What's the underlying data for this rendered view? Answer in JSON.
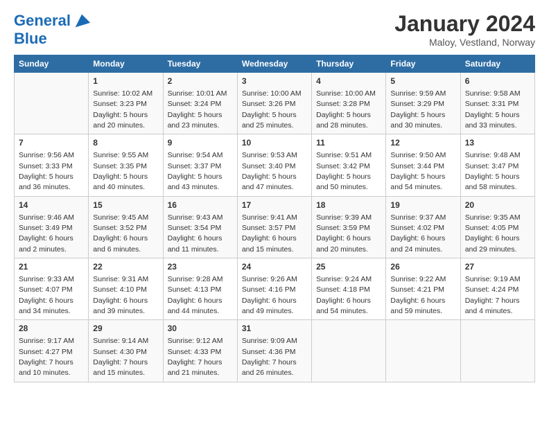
{
  "logo": {
    "line1": "General",
    "line2": "Blue"
  },
  "title": "January 2024",
  "subtitle": "Maloy, Vestland, Norway",
  "days": [
    "Sunday",
    "Monday",
    "Tuesday",
    "Wednesday",
    "Thursday",
    "Friday",
    "Saturday"
  ],
  "weeks": [
    [
      {
        "date": "",
        "sunrise": "",
        "sunset": "",
        "daylight": ""
      },
      {
        "date": "1",
        "sunrise": "Sunrise: 10:02 AM",
        "sunset": "Sunset: 3:23 PM",
        "daylight": "Daylight: 5 hours and 20 minutes."
      },
      {
        "date": "2",
        "sunrise": "Sunrise: 10:01 AM",
        "sunset": "Sunset: 3:24 PM",
        "daylight": "Daylight: 5 hours and 23 minutes."
      },
      {
        "date": "3",
        "sunrise": "Sunrise: 10:00 AM",
        "sunset": "Sunset: 3:26 PM",
        "daylight": "Daylight: 5 hours and 25 minutes."
      },
      {
        "date": "4",
        "sunrise": "Sunrise: 10:00 AM",
        "sunset": "Sunset: 3:28 PM",
        "daylight": "Daylight: 5 hours and 28 minutes."
      },
      {
        "date": "5",
        "sunrise": "Sunrise: 9:59 AM",
        "sunset": "Sunset: 3:29 PM",
        "daylight": "Daylight: 5 hours and 30 minutes."
      },
      {
        "date": "6",
        "sunrise": "Sunrise: 9:58 AM",
        "sunset": "Sunset: 3:31 PM",
        "daylight": "Daylight: 5 hours and 33 minutes."
      }
    ],
    [
      {
        "date": "7",
        "sunrise": "Sunrise: 9:56 AM",
        "sunset": "Sunset: 3:33 PM",
        "daylight": "Daylight: 5 hours and 36 minutes."
      },
      {
        "date": "8",
        "sunrise": "Sunrise: 9:55 AM",
        "sunset": "Sunset: 3:35 PM",
        "daylight": "Daylight: 5 hours and 40 minutes."
      },
      {
        "date": "9",
        "sunrise": "Sunrise: 9:54 AM",
        "sunset": "Sunset: 3:37 PM",
        "daylight": "Daylight: 5 hours and 43 minutes."
      },
      {
        "date": "10",
        "sunrise": "Sunrise: 9:53 AM",
        "sunset": "Sunset: 3:40 PM",
        "daylight": "Daylight: 5 hours and 47 minutes."
      },
      {
        "date": "11",
        "sunrise": "Sunrise: 9:51 AM",
        "sunset": "Sunset: 3:42 PM",
        "daylight": "Daylight: 5 hours and 50 minutes."
      },
      {
        "date": "12",
        "sunrise": "Sunrise: 9:50 AM",
        "sunset": "Sunset: 3:44 PM",
        "daylight": "Daylight: 5 hours and 54 minutes."
      },
      {
        "date": "13",
        "sunrise": "Sunrise: 9:48 AM",
        "sunset": "Sunset: 3:47 PM",
        "daylight": "Daylight: 5 hours and 58 minutes."
      }
    ],
    [
      {
        "date": "14",
        "sunrise": "Sunrise: 9:46 AM",
        "sunset": "Sunset: 3:49 PM",
        "daylight": "Daylight: 6 hours and 2 minutes."
      },
      {
        "date": "15",
        "sunrise": "Sunrise: 9:45 AM",
        "sunset": "Sunset: 3:52 PM",
        "daylight": "Daylight: 6 hours and 6 minutes."
      },
      {
        "date": "16",
        "sunrise": "Sunrise: 9:43 AM",
        "sunset": "Sunset: 3:54 PM",
        "daylight": "Daylight: 6 hours and 11 minutes."
      },
      {
        "date": "17",
        "sunrise": "Sunrise: 9:41 AM",
        "sunset": "Sunset: 3:57 PM",
        "daylight": "Daylight: 6 hours and 15 minutes."
      },
      {
        "date": "18",
        "sunrise": "Sunrise: 9:39 AM",
        "sunset": "Sunset: 3:59 PM",
        "daylight": "Daylight: 6 hours and 20 minutes."
      },
      {
        "date": "19",
        "sunrise": "Sunrise: 9:37 AM",
        "sunset": "Sunset: 4:02 PM",
        "daylight": "Daylight: 6 hours and 24 minutes."
      },
      {
        "date": "20",
        "sunrise": "Sunrise: 9:35 AM",
        "sunset": "Sunset: 4:05 PM",
        "daylight": "Daylight: 6 hours and 29 minutes."
      }
    ],
    [
      {
        "date": "21",
        "sunrise": "Sunrise: 9:33 AM",
        "sunset": "Sunset: 4:07 PM",
        "daylight": "Daylight: 6 hours and 34 minutes."
      },
      {
        "date": "22",
        "sunrise": "Sunrise: 9:31 AM",
        "sunset": "Sunset: 4:10 PM",
        "daylight": "Daylight: 6 hours and 39 minutes."
      },
      {
        "date": "23",
        "sunrise": "Sunrise: 9:28 AM",
        "sunset": "Sunset: 4:13 PM",
        "daylight": "Daylight: 6 hours and 44 minutes."
      },
      {
        "date": "24",
        "sunrise": "Sunrise: 9:26 AM",
        "sunset": "Sunset: 4:16 PM",
        "daylight": "Daylight: 6 hours and 49 minutes."
      },
      {
        "date": "25",
        "sunrise": "Sunrise: 9:24 AM",
        "sunset": "Sunset: 4:18 PM",
        "daylight": "Daylight: 6 hours and 54 minutes."
      },
      {
        "date": "26",
        "sunrise": "Sunrise: 9:22 AM",
        "sunset": "Sunset: 4:21 PM",
        "daylight": "Daylight: 6 hours and 59 minutes."
      },
      {
        "date": "27",
        "sunrise": "Sunrise: 9:19 AM",
        "sunset": "Sunset: 4:24 PM",
        "daylight": "Daylight: 7 hours and 4 minutes."
      }
    ],
    [
      {
        "date": "28",
        "sunrise": "Sunrise: 9:17 AM",
        "sunset": "Sunset: 4:27 PM",
        "daylight": "Daylight: 7 hours and 10 minutes."
      },
      {
        "date": "29",
        "sunrise": "Sunrise: 9:14 AM",
        "sunset": "Sunset: 4:30 PM",
        "daylight": "Daylight: 7 hours and 15 minutes."
      },
      {
        "date": "30",
        "sunrise": "Sunrise: 9:12 AM",
        "sunset": "Sunset: 4:33 PM",
        "daylight": "Daylight: 7 hours and 21 minutes."
      },
      {
        "date": "31",
        "sunrise": "Sunrise: 9:09 AM",
        "sunset": "Sunset: 4:36 PM",
        "daylight": "Daylight: 7 hours and 26 minutes."
      },
      {
        "date": "",
        "sunrise": "",
        "sunset": "",
        "daylight": ""
      },
      {
        "date": "",
        "sunrise": "",
        "sunset": "",
        "daylight": ""
      },
      {
        "date": "",
        "sunrise": "",
        "sunset": "",
        "daylight": ""
      }
    ]
  ]
}
